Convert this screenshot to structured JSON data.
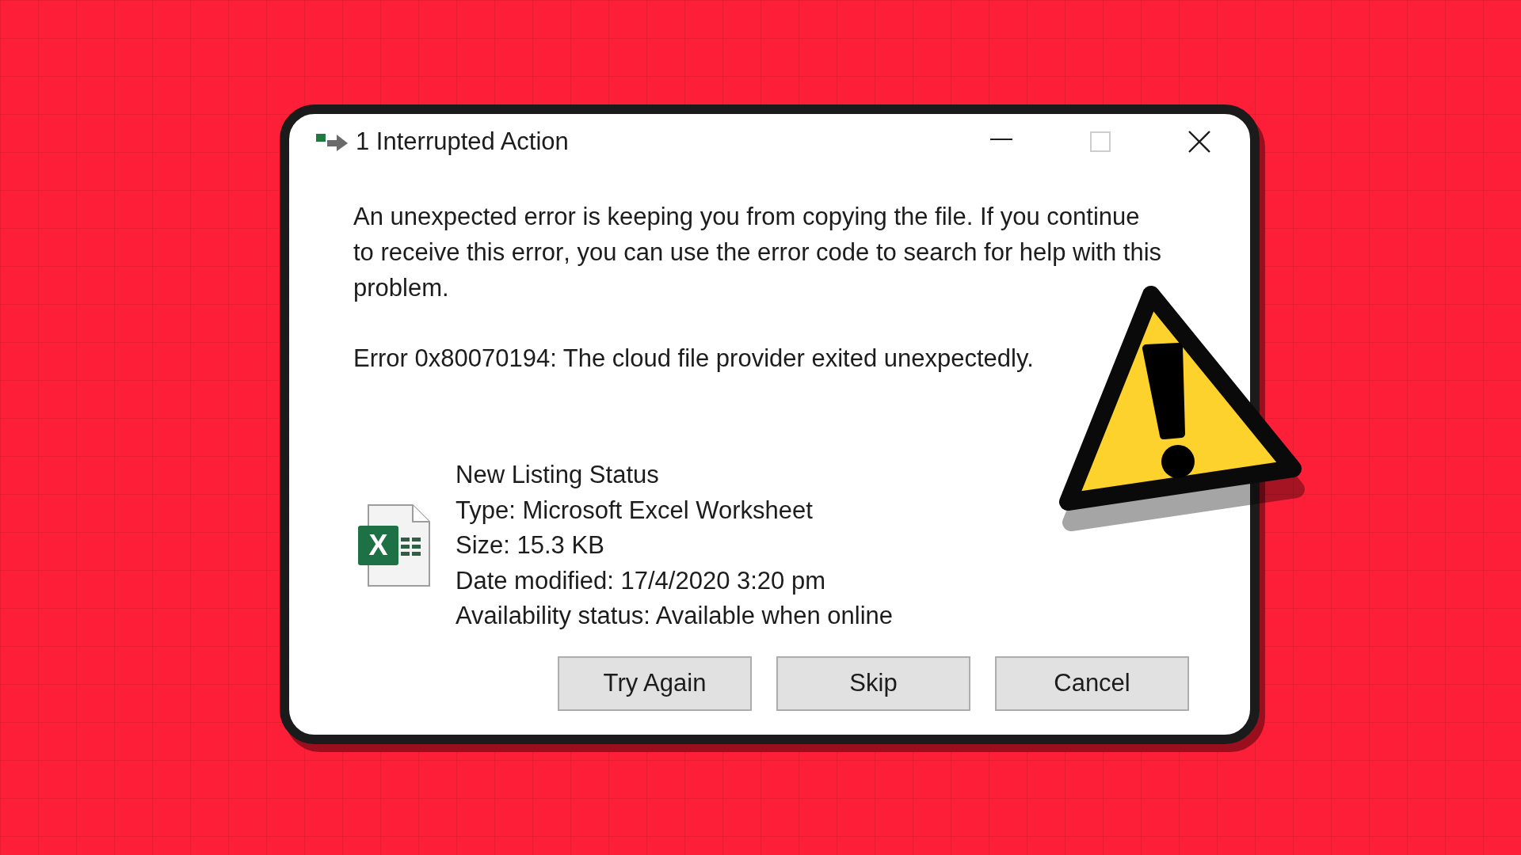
{
  "window": {
    "title": "1 Interrupted Action",
    "controls": [
      {
        "kind": "minimize",
        "disabled": false
      },
      {
        "kind": "maximize",
        "disabled": true
      },
      {
        "kind": "close",
        "disabled": false
      }
    ]
  },
  "message": "An unexpected error is keeping you from copying the file. If you continue to receive this error, you can use the error code to search for help with this problem.",
  "error": "Error 0x80070194: The cloud file provider exited unexpectedly.",
  "file": {
    "icon_letter": "X",
    "name": "New Listing Status",
    "details": [
      "Type: Microsoft Excel Worksheet",
      "Size: 15.3 KB",
      "Date modified: 17/4/2020 3:20 pm",
      "Availability status: Available when online"
    ]
  },
  "buttons": [
    "Try Again",
    "Skip",
    "Cancel"
  ]
}
